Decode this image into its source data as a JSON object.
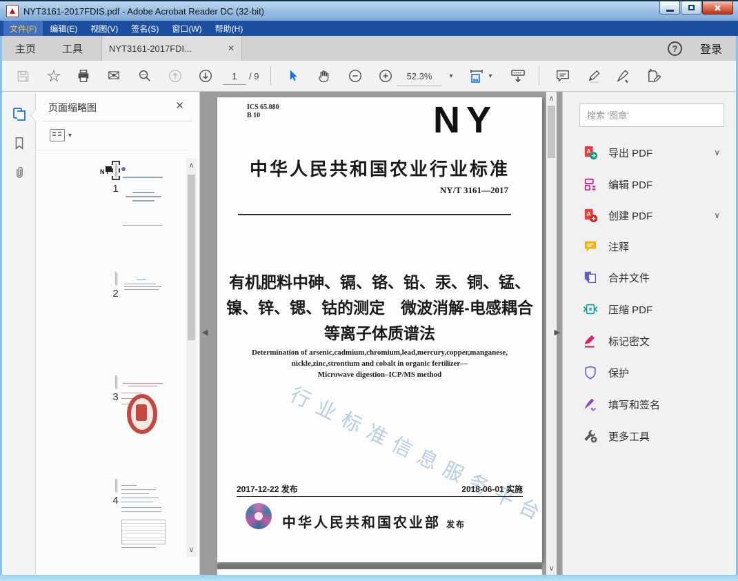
{
  "window": {
    "title": "NYT3161-2017FDIS.pdf - Adobe Acrobat Reader DC (32-bit)"
  },
  "menu": {
    "items": [
      "文件(F)",
      "编辑(E)",
      "视图(V)",
      "签名(S)",
      "窗口(W)",
      "帮助(H)"
    ]
  },
  "tabs": {
    "home": "主页",
    "tools": "工具",
    "document": "NYT3161-2017FDI...",
    "sign_in": "登录"
  },
  "toolbar": {
    "page_current": "1",
    "page_total": "/ 9",
    "zoom_level": "52.3%"
  },
  "left_panel": {
    "title": "页面缩略图",
    "thumbnails": [
      {
        "num": "1",
        "selected": true
      },
      {
        "num": "2",
        "selected": false
      },
      {
        "num": "3",
        "selected": false
      },
      {
        "num": "4",
        "selected": false
      }
    ]
  },
  "document": {
    "ics": "ICS 65.080\nB 10",
    "logo": "NY",
    "standard_title": "中华人民共和国农业行业标准",
    "standard_number": "NY/T 3161—2017",
    "title_line1": "有机肥料中砷、镉、铬、铅、汞、铜、锰、",
    "title_line2": "镍、锌、锶、钴的测定　微波消解-电感耦合",
    "title_line3": "等离子体质谱法",
    "english_line1": "Determination of arsenic,cadmium,chromium,lead,mercury,copper,manganese,",
    "english_line2": "nickle,zinc,strontium and cobalt in organic fertilizer—",
    "english_line3": "Microwave digestion–ICP/MS method",
    "watermark": "行业标准信息服务平台",
    "issue_date": "2017-12-22 发布",
    "implement_date": "2018-06-01 实施",
    "publisher": "中华人民共和国农业部",
    "publish_label": "发布"
  },
  "right_panel": {
    "search_placeholder": "搜索 '图章'",
    "tools": [
      {
        "label": "导出 PDF",
        "icon": "export-pdf-icon",
        "expandable": true
      },
      {
        "label": "编辑 PDF",
        "icon": "edit-pdf-icon",
        "expandable": false
      },
      {
        "label": "创建 PDF",
        "icon": "create-pdf-icon",
        "expandable": true
      },
      {
        "label": "注释",
        "icon": "comment-tool-icon",
        "expandable": false
      },
      {
        "label": "合并文件",
        "icon": "combine-files-icon",
        "expandable": false
      },
      {
        "label": "压缩 PDF",
        "icon": "compress-pdf-icon",
        "expandable": false
      },
      {
        "label": "标记密文",
        "icon": "redact-icon",
        "expandable": false
      },
      {
        "label": "保护",
        "icon": "protect-icon",
        "expandable": false
      },
      {
        "label": "填写和签名",
        "icon": "fill-sign-icon",
        "expandable": false
      },
      {
        "label": "更多工具",
        "icon": "more-tools-icon",
        "expandable": false
      }
    ],
    "accent_colors": {
      "export_teal": "#0d9e8a",
      "pdf_red": "#e8413c",
      "edit_magenta": "#c6258f",
      "comment_yellow": "#f0b505",
      "combine_purple": "#5f5cd0",
      "redact_pink": "#d6276b",
      "protect_blue": "#6a6ad8",
      "sign_purple": "#8a3fd1",
      "tools_gray": "#555555"
    }
  },
  "icons": {
    "close": "✕",
    "chevron_up": "∧",
    "chevron_down": "∨",
    "caret_down": "▾",
    "collapse_left": "◀",
    "collapse_right": "▶",
    "help": "?",
    "envelope": "✉",
    "star": "☆"
  }
}
